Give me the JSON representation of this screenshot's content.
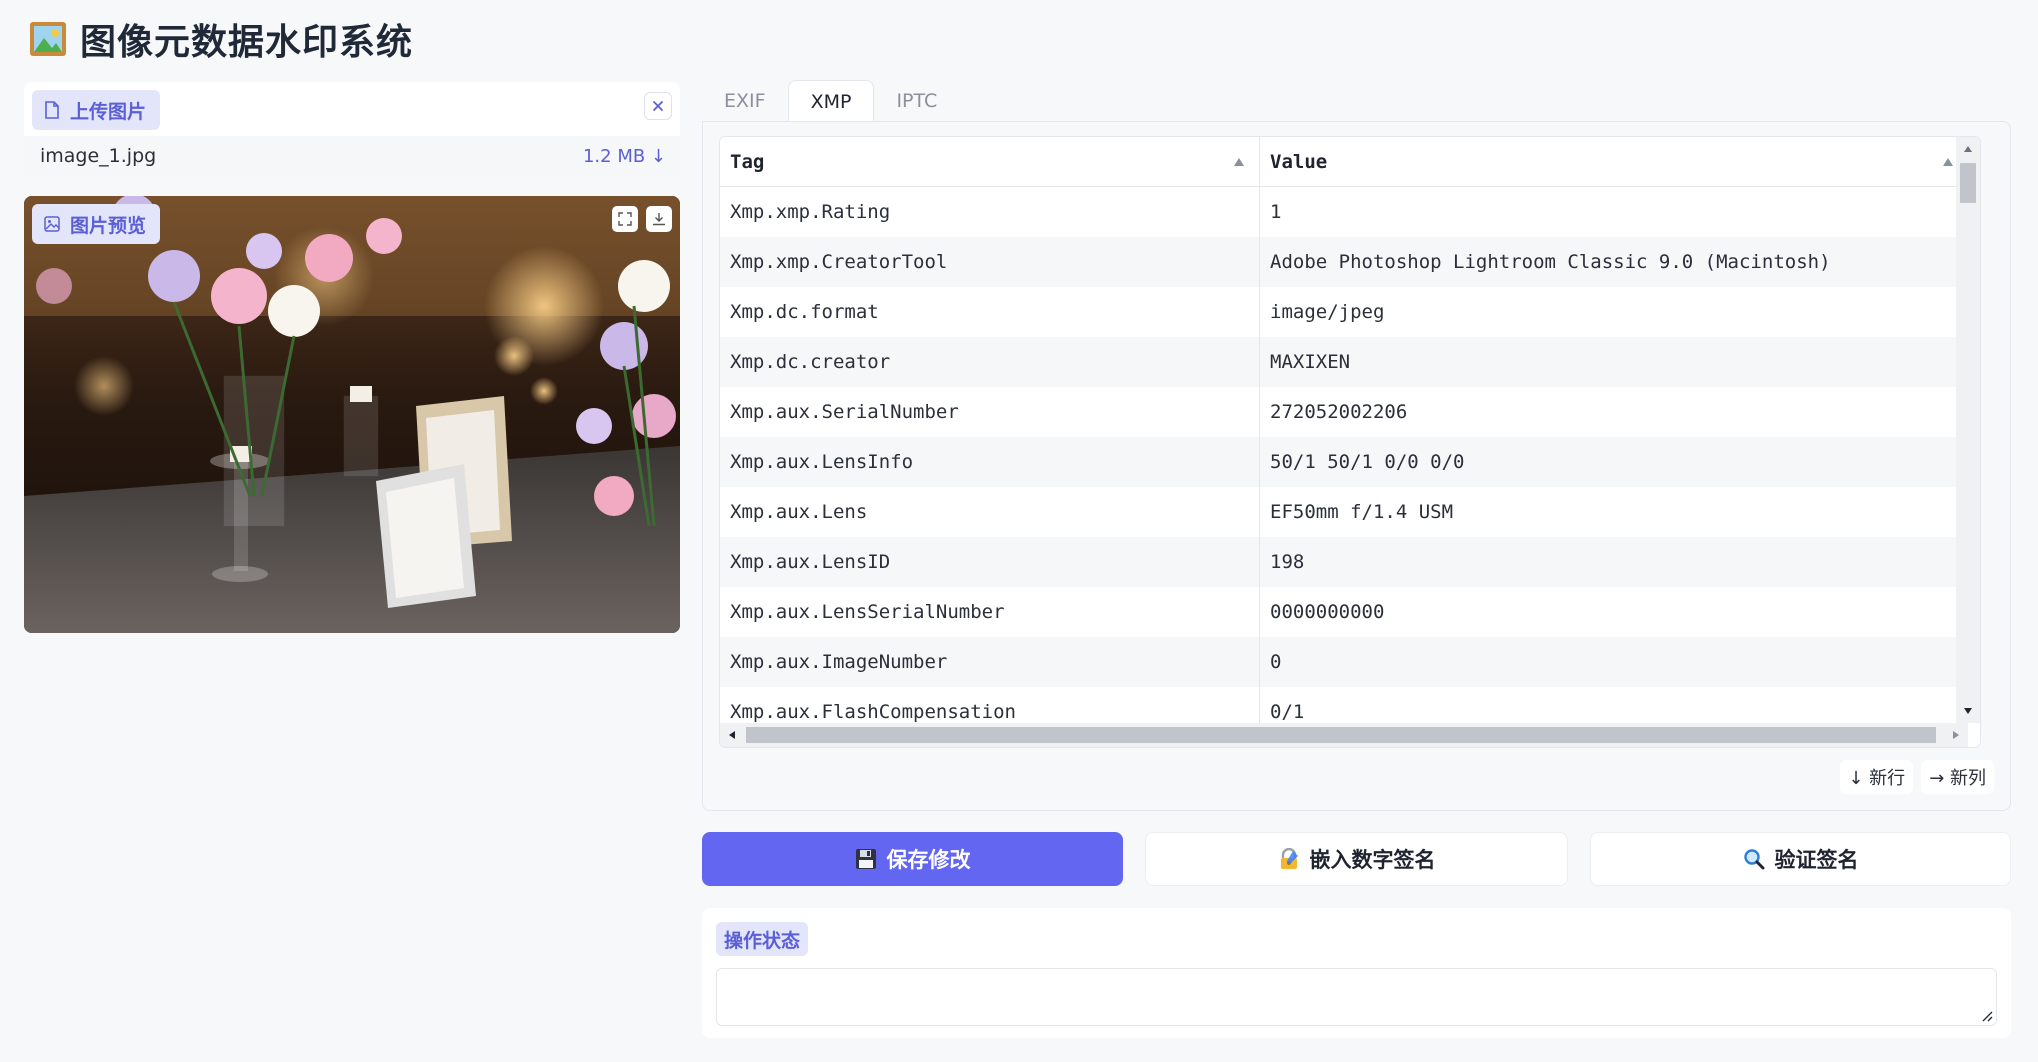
{
  "app": {
    "title": "图像元数据水印系统",
    "icon": "framed-picture-icon"
  },
  "upload": {
    "label": "上传图片",
    "file_name": "image_1.jpg",
    "file_size": "1.2 MB ↓"
  },
  "preview": {
    "label": "图片预览"
  },
  "tabs": [
    {
      "label": "EXIF",
      "active": false
    },
    {
      "label": "XMP",
      "active": true
    },
    {
      "label": "IPTC",
      "active": false
    }
  ],
  "table": {
    "headers": {
      "tag": "Tag",
      "value": "Value"
    },
    "rows": [
      {
        "tag": "Xmp.xmp.Rating",
        "value": "1"
      },
      {
        "tag": "Xmp.xmp.CreatorTool",
        "value": "Adobe Photoshop Lightroom Classic 9.0 (Macintosh)"
      },
      {
        "tag": "Xmp.dc.format",
        "value": "image/jpeg"
      },
      {
        "tag": "Xmp.dc.creator",
        "value": "MAXIXEN"
      },
      {
        "tag": "Xmp.aux.SerialNumber",
        "value": "272052002206"
      },
      {
        "tag": "Xmp.aux.LensInfo",
        "value": "50/1 50/1 0/0 0/0"
      },
      {
        "tag": "Xmp.aux.Lens",
        "value": "EF50mm f/1.4 USM"
      },
      {
        "tag": "Xmp.aux.LensID",
        "value": "198"
      },
      {
        "tag": "Xmp.aux.LensSerialNumber",
        "value": "0000000000"
      },
      {
        "tag": "Xmp.aux.ImageNumber",
        "value": "0"
      },
      {
        "tag": "Xmp.aux.FlashCompensation",
        "value": "0/1"
      }
    ],
    "new_row_label": "↓ 新行",
    "new_col_label": "→ 新列"
  },
  "actions": {
    "save_label": "保存修改",
    "sign_label": "嵌入数字签名",
    "verify_label": "验证签名"
  },
  "status": {
    "label": "操作状态",
    "value": ""
  },
  "colors": {
    "accent": "#6366f1",
    "label_bg": "#e3e6fb",
    "label_text": "#5b5fd6"
  }
}
